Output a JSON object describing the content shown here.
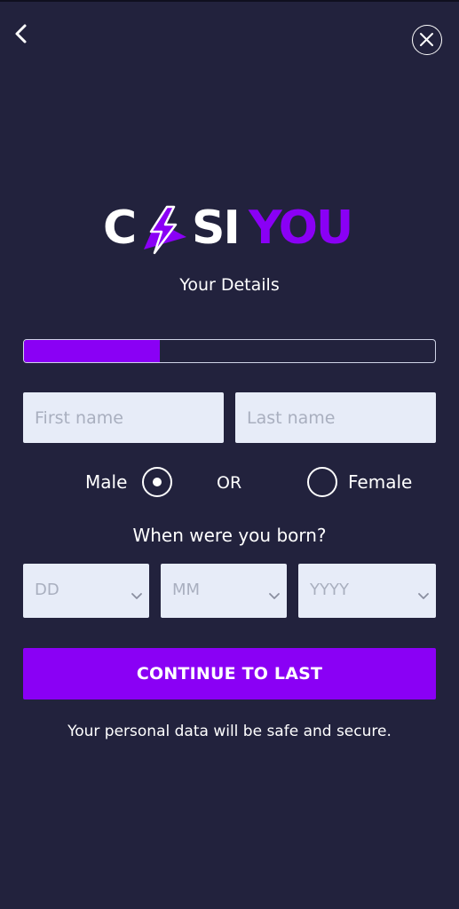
{
  "nav": {
    "back_icon": "chevron-left-icon",
    "close_icon": "close-icon"
  },
  "brand": {
    "part1": "C",
    "part2": "SI",
    "part3": "YOU",
    "bolt_icon": "lightning-bolt-icon",
    "accent_color": "#8a00f5"
  },
  "form": {
    "title": "Your Details",
    "progress": 0.33,
    "first_name_placeholder": "First name",
    "last_name_placeholder": "Last name",
    "first_name_value": "",
    "last_name_value": "",
    "gender": {
      "male_label": "Male",
      "or_label": "OR",
      "female_label": "Female",
      "selected": "Male"
    },
    "dob": {
      "question": "When were you born?",
      "day_placeholder": "DD",
      "month_placeholder": "MM",
      "year_placeholder": "YYYY"
    },
    "continue_label": "CONTINUE TO LAST",
    "secure_note": "Your personal data will be safe and secure."
  },
  "colors": {
    "background": "#22223d",
    "field_background": "#e7ecf8",
    "button": "#8a00f5"
  }
}
